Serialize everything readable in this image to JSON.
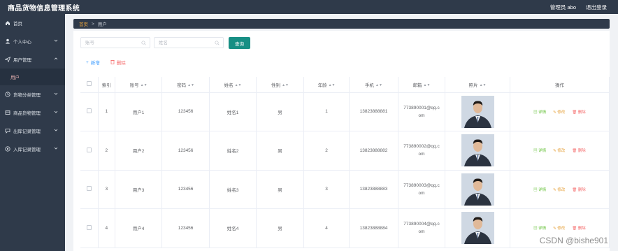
{
  "app": {
    "title": "商品货物信息管理系统",
    "admin_label": "管理员 abo",
    "logout_label": "退出登录"
  },
  "sidebar": {
    "items": [
      {
        "label": "首页",
        "icon": "home-icon"
      },
      {
        "label": "个人中心",
        "icon": "user-icon",
        "has_chevron": true
      },
      {
        "label": "用户管理",
        "icon": "send-icon",
        "has_chevron": true,
        "expanded": true
      },
      {
        "label": "货物分类管理",
        "icon": "clock-icon",
        "has_chevron": true
      },
      {
        "label": "商品货物管理",
        "icon": "box-icon",
        "has_chevron": true
      },
      {
        "label": "出库记录管理",
        "icon": "chat-icon",
        "has_chevron": true
      },
      {
        "label": "入库记录管理",
        "icon": "settings-icon",
        "has_chevron": true
      }
    ],
    "submenu_active": "用户"
  },
  "breadcrumb": {
    "home": "首页",
    "current": "用户"
  },
  "search": {
    "account_placeholder": "账号",
    "name_placeholder": "姓名",
    "query_label": "查询"
  },
  "actions": {
    "add_label": "新增",
    "delete_label": "删除"
  },
  "table": {
    "headers": [
      "索引",
      "账号",
      "密码",
      "姓名",
      "性别",
      "年龄",
      "手机",
      "邮箱",
      "照片",
      "操作"
    ],
    "rows": [
      {
        "index": "1",
        "account": "用户1",
        "password": "123456",
        "name": "姓名1",
        "gender": "男",
        "age": "1",
        "phone": "13823888881",
        "email_line1": "773890001@qq.c",
        "email_line2": "om"
      },
      {
        "index": "2",
        "account": "用户2",
        "password": "123456",
        "name": "姓名2",
        "gender": "男",
        "age": "2",
        "phone": "13823888882",
        "email_line1": "773890002@qq.c",
        "email_line2": "om"
      },
      {
        "index": "3",
        "account": "用户3",
        "password": "123456",
        "name": "姓名3",
        "gender": "男",
        "age": "3",
        "phone": "13823888883",
        "email_line1": "773890003@qq.c",
        "email_line2": "om"
      },
      {
        "index": "4",
        "account": "用户4",
        "password": "123456",
        "name": "姓名4",
        "gender": "男",
        "age": "4",
        "phone": "13823888884",
        "email_line1": "773890004@qq.c",
        "email_line2": "om"
      }
    ],
    "op_detail": "详情",
    "op_edit": "修改",
    "op_delete": "删除"
  },
  "watermark": "CSDN @bishe901",
  "colors": {
    "sidebar_bg": "#2f3a4a",
    "accent_teal": "#178f84",
    "link_blue": "#409eff",
    "danger_red": "#f56c6c",
    "success_green": "#67c23a",
    "warning_orange": "#e6a23c"
  }
}
